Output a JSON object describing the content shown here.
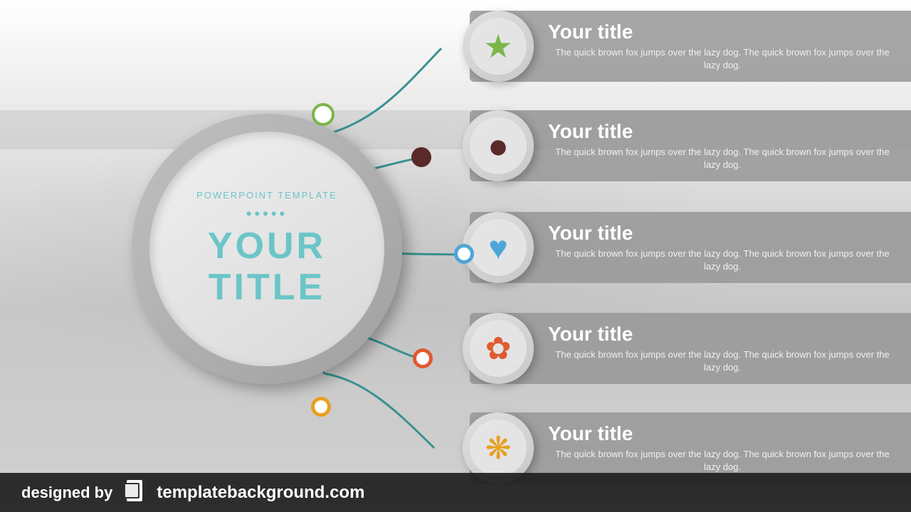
{
  "background": {
    "color_top": "#ffffff",
    "color_bottom": "#c8c8c8"
  },
  "center_circle": {
    "subtitle": "POWERPOINT TEMPLATE",
    "dots": "•••••",
    "title_line1": "YOUR",
    "title_line2": "TITLE"
  },
  "items": [
    {
      "id": 1,
      "title": "Your title",
      "description": "The quick brown fox jumps over the lazy dog. The quick brown fox jumps over the lazy dog.",
      "icon": "★",
      "icon_color": "#7ab648",
      "node_color": "#7ab648",
      "node_border": "#7ab648"
    },
    {
      "id": 2,
      "title": "Your title",
      "description": "The quick brown fox jumps over the lazy dog. The quick brown fox jumps over the lazy dog.",
      "icon": "●",
      "icon_color": "#5a2a2a",
      "node_color": "#5a2a2a",
      "node_border": "#5a2a2a"
    },
    {
      "id": 3,
      "title": "Your title",
      "description": "The quick brown fox jumps over the lazy dog. The quick brown fox jumps over the lazy dog.",
      "icon": "♥",
      "icon_color": "#4da6d8",
      "node_color": "#4da6d8",
      "node_border": "#4da6d8"
    },
    {
      "id": 4,
      "title": "Your title",
      "description": "The quick brown fox jumps over the lazy dog. The quick brown fox jumps over the lazy dog.",
      "icon": "✿",
      "icon_color": "#e05a30",
      "node_color": "#e05a30",
      "node_border": "#e05a30"
    },
    {
      "id": 5,
      "title": "Your title",
      "description": "The quick brown fox jumps over the lazy dog. The quick brown fox jumps over the lazy dog.",
      "icon": "❋",
      "icon_color": "#e8a020",
      "node_color": "#e8a020",
      "node_border": "#e8a020"
    }
  ],
  "footer": {
    "designed_by": "designed by",
    "url": "templatebackground.com"
  },
  "curve_color": "#3a9090"
}
